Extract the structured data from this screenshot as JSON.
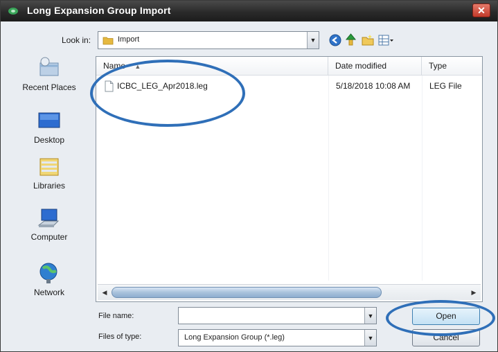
{
  "window": {
    "title": "Long Expansion Group Import",
    "close_icon": "close-icon"
  },
  "toolbar": {
    "look_in_label": "Look in:",
    "look_in_value": "Import",
    "icons": [
      "back-icon",
      "up-folder-icon",
      "new-folder-icon",
      "views-menu-icon"
    ]
  },
  "places": [
    {
      "label": "Recent Places",
      "icon": "recent-places-icon"
    },
    {
      "label": "Desktop",
      "icon": "desktop-icon"
    },
    {
      "label": "Libraries",
      "icon": "libraries-icon"
    },
    {
      "label": "Computer",
      "icon": "computer-icon"
    },
    {
      "label": "Network",
      "icon": "network-icon"
    }
  ],
  "file_list": {
    "columns": [
      {
        "label": "Name"
      },
      {
        "label": "Date modified"
      },
      {
        "label": "Type"
      }
    ],
    "rows": [
      {
        "name": "ICBC_LEG_Apr2018.leg",
        "date_modified": "5/18/2018 10:08 AM",
        "type": "LEG File"
      }
    ]
  },
  "footer": {
    "file_name_label": "File name:",
    "file_name_value": "",
    "file_type_label": "Files of type:",
    "file_type_value": "Long Expansion Group (*.leg)",
    "open_label": "Open",
    "cancel_label": "Cancel"
  },
  "annotation_color": "#2f6fb8"
}
